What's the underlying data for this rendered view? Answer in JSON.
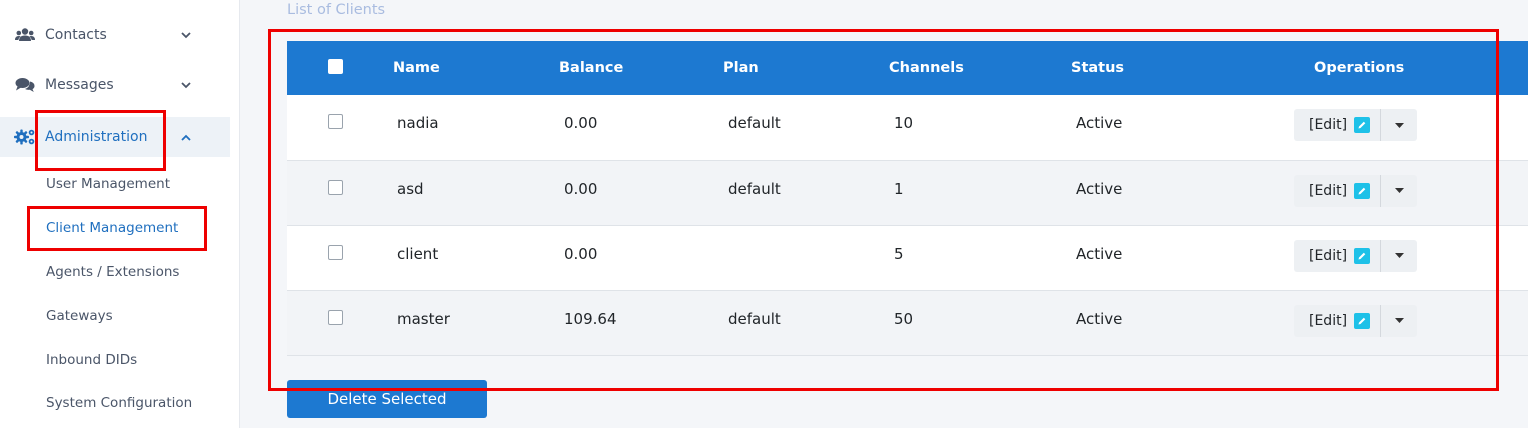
{
  "sidebar": {
    "items": [
      {
        "label": "Contacts",
        "icon": "users-icon",
        "expanded": false
      },
      {
        "label": "Messages",
        "icon": "comments-icon",
        "expanded": false
      },
      {
        "label": "Administration",
        "icon": "cogs-icon",
        "expanded": true
      }
    ],
    "subitems": [
      {
        "label": "User Management",
        "active": false
      },
      {
        "label": "Client Management",
        "active": true
      },
      {
        "label": "Agents / Extensions",
        "active": false
      },
      {
        "label": "Gateways",
        "active": false
      },
      {
        "label": "Inbound DIDs",
        "active": false
      },
      {
        "label": "System Configuration",
        "active": false
      }
    ]
  },
  "main": {
    "title": "List of Clients",
    "table": {
      "columns": [
        "Name",
        "Balance",
        "Plan",
        "Channels",
        "Status",
        "Operations"
      ],
      "rows": [
        {
          "name": "nadia",
          "balance": "0.00",
          "plan": "default",
          "channels": "10",
          "status": "Active"
        },
        {
          "name": "asd",
          "balance": "0.00",
          "plan": "default",
          "channels": "1",
          "status": "Active"
        },
        {
          "name": "client",
          "balance": "0.00",
          "plan": "",
          "channels": "5",
          "status": "Active"
        },
        {
          "name": "master",
          "balance": "109.64",
          "plan": "default",
          "channels": "50",
          "status": "Active"
        }
      ],
      "edit_label": "[Edit]"
    },
    "delete_label": "Delete Selected"
  },
  "colors": {
    "accent": "#1d79d1",
    "highlight": "#ee0000",
    "edit_icon": "#1ec1e8"
  }
}
